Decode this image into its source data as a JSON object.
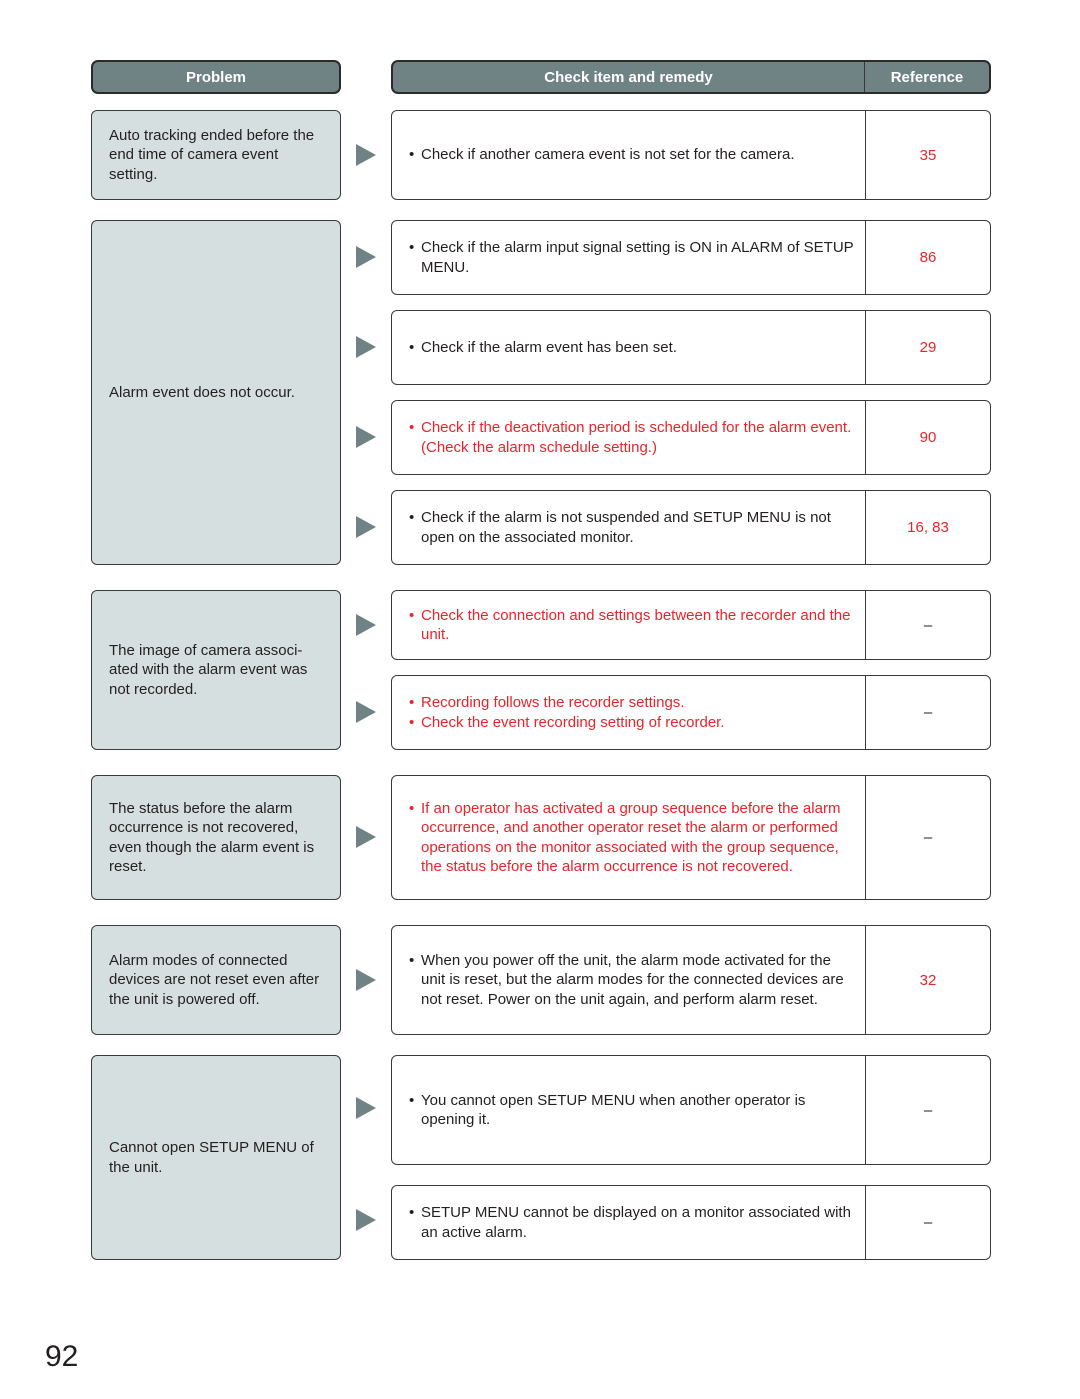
{
  "headers": {
    "problem": "Problem",
    "check": "Check item and remedy",
    "reference": "Reference"
  },
  "colors": {
    "header_bg": "#6f8385",
    "problem_bg": "#d6dfe0",
    "arrow": "#6f8385",
    "highlight_red": "#e8242a"
  },
  "rows": [
    {
      "problem": "Auto tracking ended before the end time of camera event setting.",
      "remedies": [
        {
          "items": [
            "Check if another camera event is not set for the camera."
          ],
          "red": false,
          "reference": "35"
        }
      ]
    },
    {
      "problem": "Alarm event does not occur.",
      "remedies": [
        {
          "items": [
            "Check if the alarm input signal setting is ON in ALARM of SETUP MENU."
          ],
          "red": false,
          "reference": "86"
        },
        {
          "items": [
            "Check if the alarm event has been set."
          ],
          "red": false,
          "reference": "29"
        },
        {
          "items": [
            "Check if the deactivation period is scheduled for the alarm event. (Check the alarm schedule setting.)"
          ],
          "red": true,
          "reference": "90"
        },
        {
          "items": [
            "Check if the alarm is not suspended and SETUP MENU is not open on the associated monitor."
          ],
          "red": false,
          "reference": "16, 83"
        }
      ]
    },
    {
      "problem": "The image of camera associ-ated with the alarm event was not recorded.",
      "remedies": [
        {
          "items": [
            "Check the connection and settings between the recorder and the unit."
          ],
          "red": true,
          "reference": "–"
        },
        {
          "items": [
            "Recording follows the recorder settings.",
            "Check the event recording setting of recorder."
          ],
          "red": true,
          "reference": "–"
        }
      ]
    },
    {
      "problem": "The status before the alarm occurrence is not recovered, even though the alarm event is reset.",
      "remedies": [
        {
          "items": [
            "If an operator has activated a group sequence before the alarm occurrence, and another operator reset the alarm or performed operations on the monitor associated with the group sequence, the status before the alarm occurrence is not recovered."
          ],
          "red": true,
          "reference": "–"
        }
      ]
    },
    {
      "problem": "Alarm modes of connected devices are not reset even after the unit is powered off.",
      "remedies": [
        {
          "items": [
            "When you power off the unit, the alarm mode activated for the unit is reset, but the alarm modes for the connected devices are not reset. Power on the unit again, and perform alarm reset."
          ],
          "red": false,
          "reference": "32"
        }
      ]
    },
    {
      "problem": "Cannot open SETUP MENU of the unit.",
      "remedies": [
        {
          "items": [
            "You cannot open SETUP MENU when another operator is opening it."
          ],
          "red": false,
          "reference": "–"
        },
        {
          "items": [
            "SETUP MENU cannot be displayed on a monitor associated with an active alarm."
          ],
          "red": false,
          "reference": "–"
        }
      ]
    }
  ],
  "bullet": "•",
  "page_number": "92"
}
